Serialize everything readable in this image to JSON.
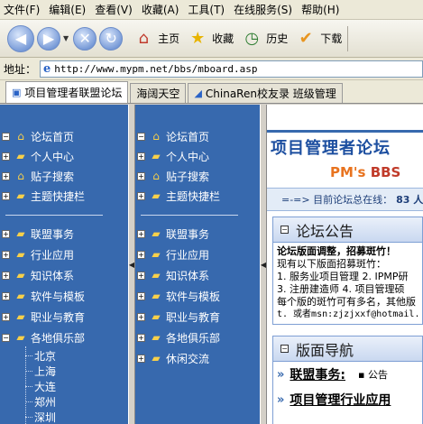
{
  "menu": [
    "文件(F)",
    "编辑(E)",
    "查看(V)",
    "收藏(A)",
    "工具(T)",
    "在线服务(S)",
    "帮助(H)"
  ],
  "toolbar": {
    "home": "主页",
    "favorites": "收藏",
    "history": "历史",
    "download": "下载"
  },
  "address": {
    "label": "地址：",
    "url": "http://www.mypm.net/bbs/mboard.asp"
  },
  "tabs": [
    {
      "label": "项目管理者联盟论坛",
      "active": true
    },
    {
      "label": "海阔天空",
      "active": false
    },
    {
      "label": "ChinaRen校友录 班级管理",
      "active": false
    }
  ],
  "sidebar1": {
    "top_items": [
      "论坛首页",
      "个人中心",
      "贴子搜索",
      "主题快捷栏"
    ],
    "bottom_items": [
      "联盟事务",
      "行业应用",
      "知识体系",
      "软件与模板",
      "职业与教育",
      "各地俱乐部"
    ],
    "sub_items": [
      "北京",
      "上海",
      "大连",
      "郑州",
      "深圳"
    ]
  },
  "sidebar2": {
    "top_items": [
      "论坛首页",
      "个人中心",
      "贴子搜索",
      "主题快捷栏"
    ],
    "bottom_items": [
      "联盟事务",
      "行业应用",
      "知识体系",
      "软件与模板",
      "职业与教育",
      "各地俱乐部",
      "休闲交流"
    ]
  },
  "main": {
    "site_title": "项目管理者论坛",
    "logo_pm": "PM's",
    "logo_bbs": "BBS",
    "status_text": "=-=> 目前论坛总在线：",
    "status_count": "83 人",
    "notice": {
      "title": "论坛公告",
      "lines": [
        "论坛版面调整，招募斑竹！",
        "现有以下版面招募斑竹：",
        "1. 服务业项目管理 2. IPMP研",
        "3. 注册建造师 4. 项目管理硕",
        "每个版的斑竹可有多名，其他版",
        "t. 或者msn:zjzjxxf@hotmail."
      ]
    },
    "section": {
      "title": "版面导航",
      "row1": "联盟事务:",
      "row1_note": "▪ 公告",
      "row2": "项目管理行业应用"
    }
  }
}
